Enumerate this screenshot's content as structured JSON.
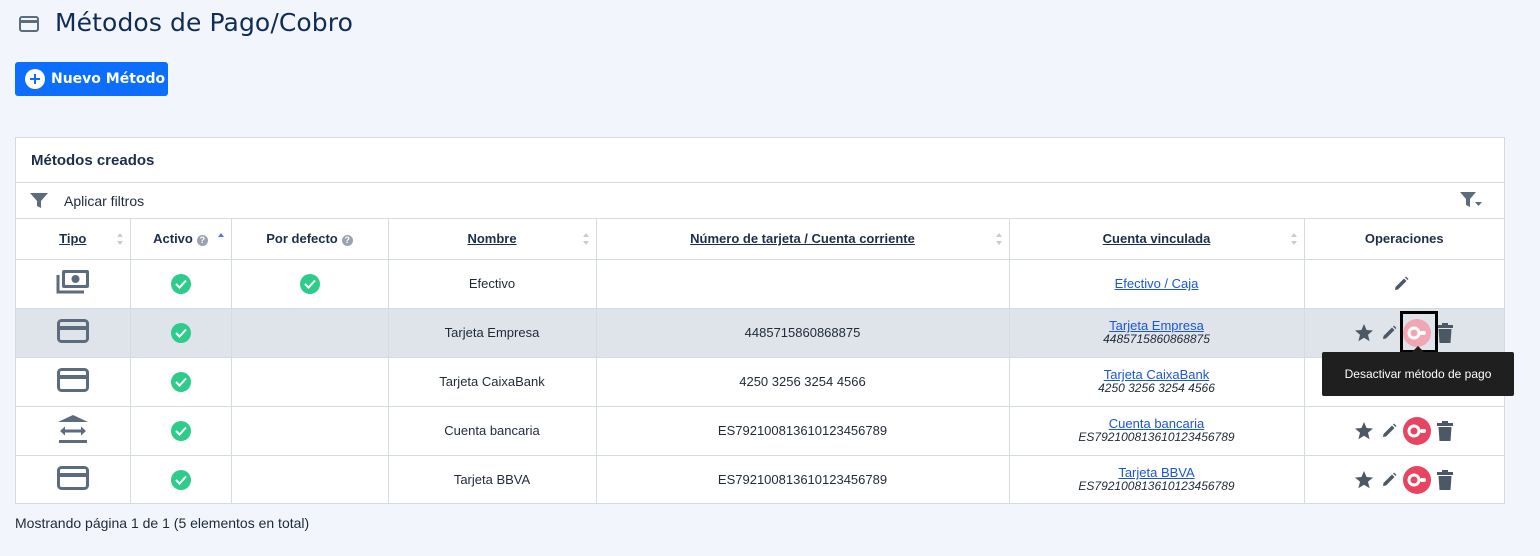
{
  "page": {
    "title": "Métodos de Pago/Cobro"
  },
  "toolbar": {
    "new_label": "Nuevo Método"
  },
  "panel": {
    "title": "Métodos creados",
    "filter_label": "Aplicar filtros"
  },
  "table": {
    "columns": [
      "Tipo",
      "Activo",
      "Por defecto",
      "Nombre",
      "Número de tarjeta / Cuenta corriente",
      "Cuenta vinculada",
      "Operaciones"
    ],
    "rows": [
      {
        "type_icon": "cash-icon",
        "active": true,
        "default": true,
        "name": "Efectivo",
        "number": "",
        "account": "Efectivo / Caja",
        "account_sub": ""
      },
      {
        "type_icon": "credit-card-icon",
        "active": true,
        "default": false,
        "name": "Tarjeta Empresa",
        "number": "4485715860868875",
        "account": "Tarjeta Empresa",
        "account_sub": "4485715860868875"
      },
      {
        "type_icon": "credit-card-icon",
        "active": true,
        "default": false,
        "name": "Tarjeta CaixaBank",
        "number": "4250 3256 3254 4566",
        "account": "Tarjeta CaixaBank",
        "account_sub": "4250 3256 3254 4566"
      },
      {
        "type_icon": "bank-transfer-icon",
        "active": true,
        "default": false,
        "name": "Cuenta bancaria",
        "number": "ES7921008136101234567​89",
        "account": "Cuenta bancaria",
        "account_sub": "ES792100813610123456789"
      },
      {
        "type_icon": "credit-card-icon",
        "active": true,
        "default": false,
        "name": "Tarjeta BBVA",
        "number": "ES792100813610123456789",
        "account": "Tarjeta BBVA",
        "account_sub": "ES792100813610123456789"
      }
    ]
  },
  "tooltip": {
    "text": "Desactivar método de pago"
  },
  "footer": {
    "text": "Mostrando página 1 de 1 (5 elementos en total)"
  },
  "colors": {
    "primary": "#0d6efd",
    "active_green": "#2ecc8a",
    "toggle_red": "#e64461",
    "icon_gray": "#5d6b7e"
  }
}
